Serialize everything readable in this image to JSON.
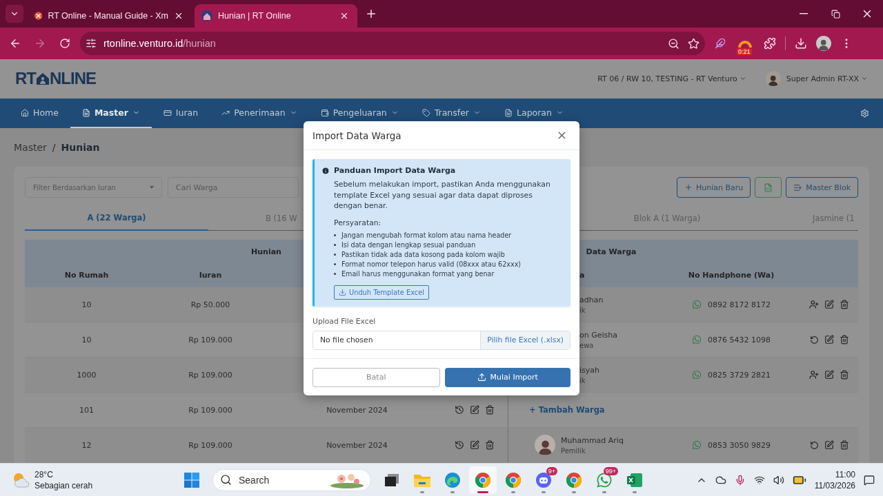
{
  "browser": {
    "tabs": [
      {
        "title": "RT Online - Manual Guide - Xm",
        "selected": false,
        "kind": "guide"
      },
      {
        "title": "Hunian | RT Online",
        "selected": true,
        "kind": "app"
      }
    ],
    "url": {
      "host": "rtonline.venturo.id",
      "path": "/hunian"
    },
    "extension_badge": "0:21"
  },
  "header": {
    "logo": {
      "left": "RT",
      "right": "NLINE"
    },
    "location": "RT 06 / RW 10, TESTING - RT Venturo",
    "user": "Super Admin RT-XX"
  },
  "nav": [
    {
      "label": "Home",
      "kind": "home",
      "dropdown": false,
      "selected": false
    },
    {
      "label": "Master",
      "kind": "file",
      "dropdown": true,
      "selected": true
    },
    {
      "label": "Iuran",
      "kind": "card",
      "dropdown": false,
      "selected": false
    },
    {
      "label": "Penerimaan",
      "kind": "chart",
      "dropdown": true,
      "selected": false
    },
    {
      "label": "Pengeluaran",
      "kind": "wallet",
      "dropdown": true,
      "selected": false
    },
    {
      "label": "Transfer",
      "kind": "tag",
      "dropdown": true,
      "selected": false
    },
    {
      "label": "Laporan",
      "kind": "file",
      "dropdown": true,
      "selected": false
    }
  ],
  "breadcrumb": {
    "separator": "/",
    "items": [
      {
        "label": "Master",
        "current": false
      },
      {
        "label": "Hunian",
        "current": true
      }
    ]
  },
  "filters": {
    "iuran_placeholder": "Filter Berdasarkan Iuran",
    "search_placeholder": "Cari Warga"
  },
  "actions": [
    {
      "label": "Hunian Baru",
      "kind": "add"
    },
    {
      "kind": "excel"
    },
    {
      "label": "Master Blok",
      "kind": "blok"
    }
  ],
  "block_tabs": [
    {
      "label": "A (22 Warga)",
      "selected": true
    },
    {
      "label": "B (16 W",
      "selected": false
    },
    {
      "label": "Blok A (1 Warga)",
      "selected": false
    },
    {
      "label": "Jasmine (1",
      "selected": false
    }
  ],
  "table": {
    "groups": [
      "Hunian",
      "Data Warga"
    ],
    "columns": {
      "no_rumah": "No Rumah",
      "iuran": "Iuran",
      "nama": "a",
      "phone": "No Handphone (Wa)"
    },
    "rows": [
      {
        "kind": "resident",
        "covered": true,
        "no_rumah": "10",
        "iuran": "Rp 50.000",
        "name": "adhan",
        "role": "ik",
        "phone": "0892 8172 8172",
        "assign": true
      },
      {
        "kind": "resident",
        "covered": true,
        "no_rumah": "10",
        "iuran": "Rp 109.000",
        "name": "on Geisha",
        "role": "ewa",
        "phone": "0876 5432 1098",
        "assign": false
      },
      {
        "kind": "resident",
        "covered": true,
        "no_rumah": "1000",
        "iuran": "Rp 109.000",
        "name": "isyah",
        "role": "ik",
        "phone": "0825 3729 2821",
        "assign": true
      },
      {
        "kind": "empty",
        "covered": false,
        "no_rumah": "101",
        "iuran": "Rp 109.000",
        "periode": "November 2024",
        "add_label": "+ Tambah Warga"
      },
      {
        "kind": "resident",
        "covered": false,
        "no_rumah": "12",
        "iuran": "Rp 109.000",
        "periode": "November 2024",
        "name": "Muhammad Ariq",
        "role": "Pemilik",
        "phone": "0853 3050 9829",
        "assign": false
      }
    ]
  },
  "modal": {
    "title": "Import Data Warga",
    "guide": {
      "title": "Panduan Import Data Warga",
      "text": "Sebelum melakukan import, pastikan Anda menggunakan template Excel yang sesuai agar data dapat diproses dengan benar.",
      "requirements_title": "Persyaratan:",
      "requirements": [
        "Jangan mengubah format kolom atau nama header",
        "Isi data dengan lengkap sesuai panduan",
        "Pastikan tidak ada data kosong pada kolom wajib",
        "Format nomor telepon harus valid (08xxx atau 62xxx)",
        "Email harus menggunakan format yang benar"
      ],
      "template_button": "Unduh Template Excel"
    },
    "upload": {
      "label": "Upload File Excel",
      "value": "No file chosen",
      "button": "Pilih file Excel (.xlsx)"
    },
    "cancel": "Batal",
    "submit": "Mulai Import"
  },
  "taskbar": {
    "weather": {
      "temp": "28°C",
      "text": "Sebagian cerah"
    },
    "search_label": "Search",
    "apps": [
      {
        "kind": "taskview",
        "open": false,
        "selected": false
      },
      {
        "kind": "explorer",
        "open": true,
        "selected": false
      },
      {
        "kind": "edge",
        "open": true,
        "selected": false
      },
      {
        "kind": "chrome",
        "open": true,
        "selected": true
      },
      {
        "kind": "chrome",
        "open": true,
        "selected": false
      },
      {
        "kind": "discord",
        "open": true,
        "selected": false,
        "badge": "9+"
      },
      {
        "kind": "chrome",
        "open": true,
        "selected": false
      },
      {
        "kind": "whatsapp",
        "open": true,
        "selected": false,
        "badge": "99+"
      },
      {
        "kind": "excel",
        "open": true,
        "selected": false
      }
    ],
    "time": "11:00",
    "date": "11/03/2026"
  }
}
